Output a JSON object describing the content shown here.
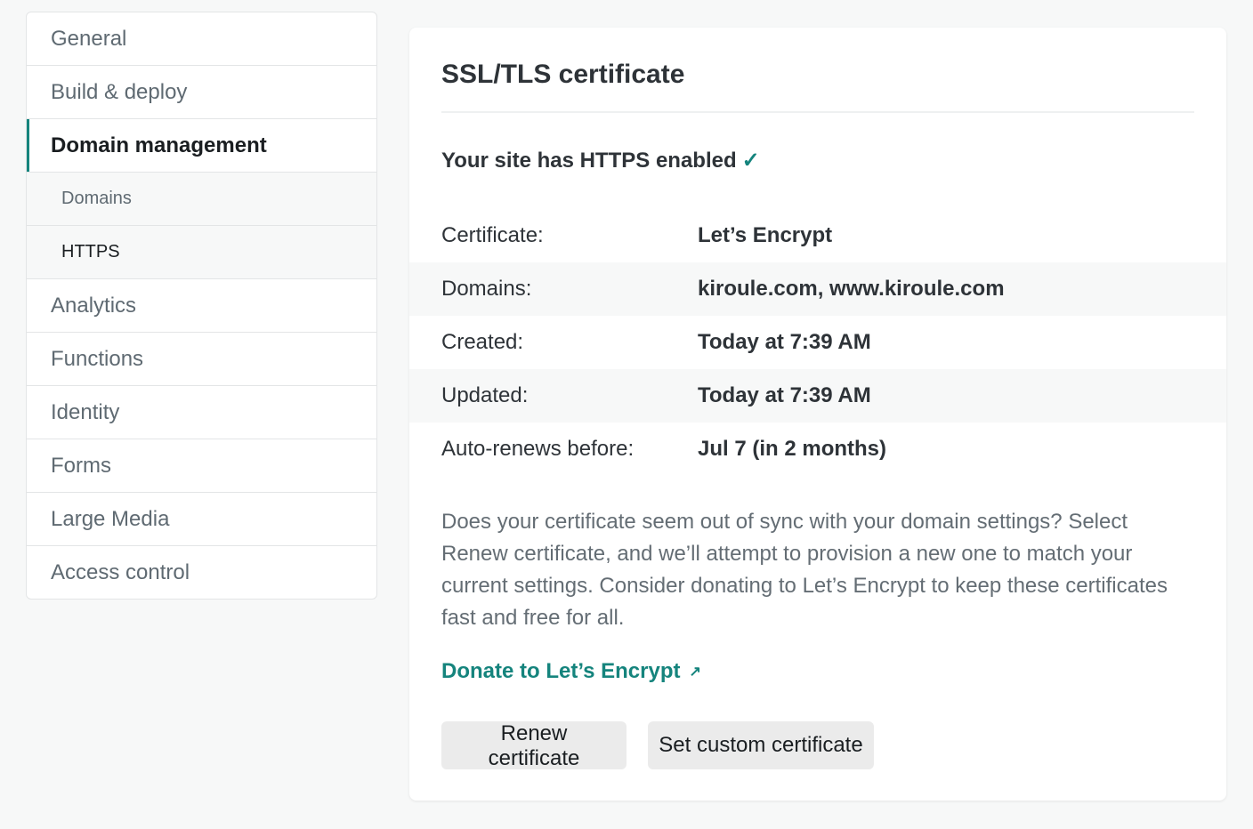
{
  "sidebar": {
    "items": [
      {
        "label": "General"
      },
      {
        "label": "Build & deploy"
      },
      {
        "label": "Domain management"
      },
      {
        "label": "Analytics"
      },
      {
        "label": "Functions"
      },
      {
        "label": "Identity"
      },
      {
        "label": "Forms"
      },
      {
        "label": "Large Media"
      },
      {
        "label": "Access control"
      }
    ],
    "subitems": [
      {
        "label": "Domains"
      },
      {
        "label": "HTTPS"
      }
    ],
    "active": "Domain management",
    "active_sub": "HTTPS"
  },
  "card": {
    "title": "SSL/TLS certificate",
    "status_text": "Your site has HTTPS enabled",
    "status_check": "✓",
    "details": [
      {
        "label": "Certificate:",
        "value": "Let’s Encrypt"
      },
      {
        "label": "Domains:",
        "value": "kiroule.com, www.kiroule.com"
      },
      {
        "label": "Created:",
        "value": "Today at 7:39 AM"
      },
      {
        "label": "Updated:",
        "value": "Today at 7:39 AM"
      },
      {
        "label": "Auto-renews before:",
        "value": "Jul 7 (in 2 months)"
      }
    ],
    "help_text": "Does your certificate seem out of sync with your domain settings? Select Renew certificate, and we’ll attempt to provision a new one to match your current settings. Consider donating to Let’s Encrypt to keep these certificates fast and free for all.",
    "donate_link": "Donate to Let’s Encrypt",
    "external_icon": "↗",
    "buttons": {
      "renew": "Renew certificate",
      "custom": "Set custom certificate"
    }
  },
  "colors": {
    "accent": "#15847d",
    "background": "#f7f8f8"
  }
}
